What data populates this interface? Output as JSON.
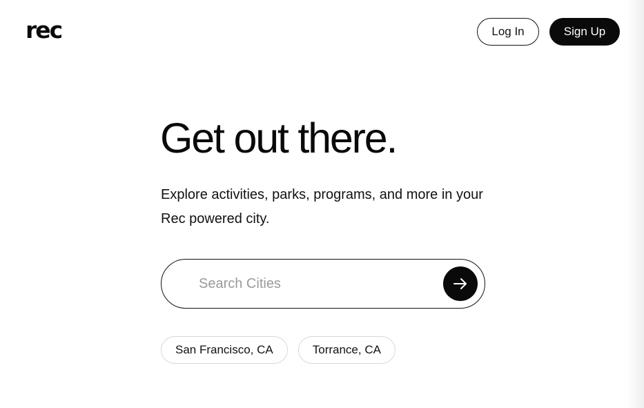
{
  "header": {
    "logo_text": "rec",
    "login_label": "Log In",
    "signup_label": "Sign Up"
  },
  "hero": {
    "headline": "Get out there.",
    "subtext": "Explore activities, parks, programs, and more in your Rec powered city."
  },
  "search": {
    "placeholder": "Search Cities",
    "value": "",
    "submit_icon": "arrow-right-icon"
  },
  "suggestions": [
    {
      "label": "San Francisco, CA"
    },
    {
      "label": "Torrance, CA"
    }
  ],
  "colors": {
    "primary": "#0a0a0a",
    "background": "#ffffff",
    "placeholder": "#9a9a9a",
    "chip_border": "#d8d8d8"
  }
}
